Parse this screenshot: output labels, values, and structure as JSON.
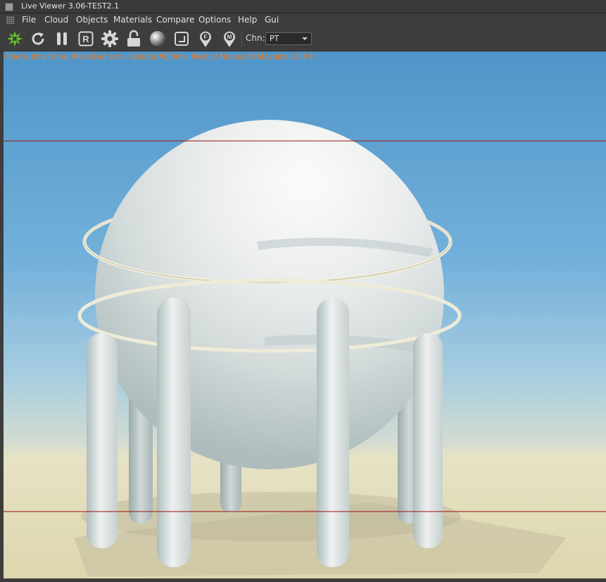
{
  "window": {
    "title": "Live Viewer 3.06-TEST2.1"
  },
  "menu": [
    "File",
    "Cloud",
    "Objects",
    "Materials",
    "Compare",
    "Options",
    "Help",
    "Gui"
  ],
  "toolbar": {
    "channel_label": "Chn:",
    "channel_value": "PT",
    "icons": [
      "octane-logo-icon",
      "refresh-icon",
      "pause-icon",
      "render-region-icon",
      "settings-gear-icon",
      "lock-icon",
      "material-sphere-icon",
      "resize-icon",
      "focus-pick-icon",
      "material-pick-icon"
    ]
  },
  "viewport": {
    "stats": "Check:0ms./1ms. MeshGen:1ms. Update[M]:0ms. Mesh:2 Nodes:38 Movable:12  0 0"
  },
  "colors": {
    "stats_text": "#ff7a1a",
    "accent_green": "#5ec127",
    "guide_line": "#9a1010"
  }
}
